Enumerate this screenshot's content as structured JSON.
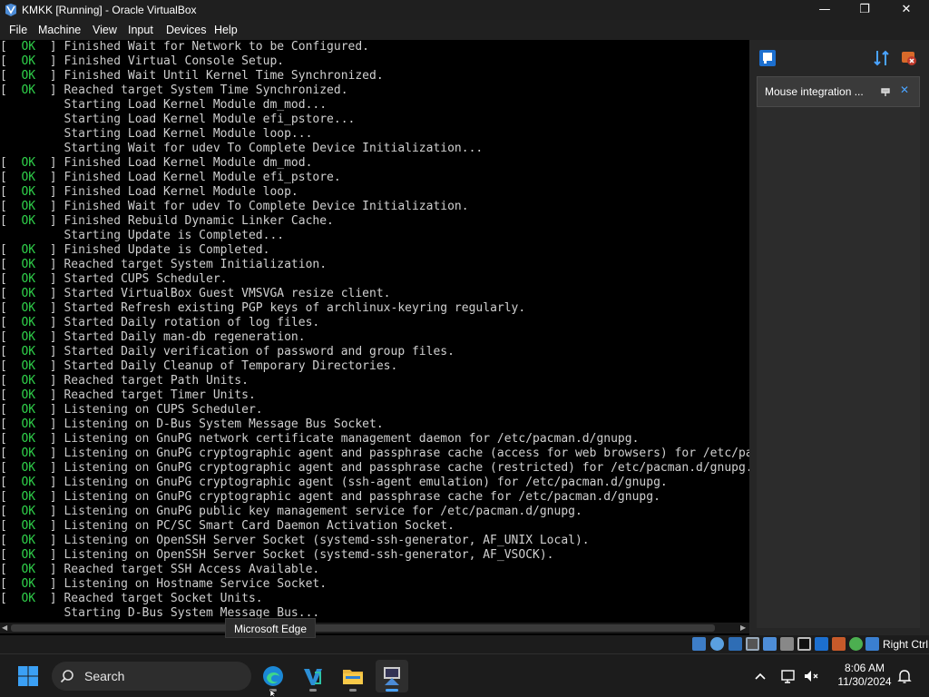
{
  "window": {
    "title": "KMKK [Running] - Oracle VirtualBox",
    "controls": {
      "minimize": "—",
      "maximize": "❐",
      "close": "✕"
    }
  },
  "menu": [
    "File",
    "Machine",
    "View",
    "Input",
    "Devices",
    "Help"
  ],
  "console": {
    "lines": [
      {
        "s": "ok",
        "verb": "Finished",
        "text": "Wait for Network to be Configured."
      },
      {
        "s": "ok",
        "verb": "Finished",
        "text": "Virtual Console Setup."
      },
      {
        "s": "ok",
        "verb": "Finished",
        "text": "Wait Until Kernel Time Synchronized."
      },
      {
        "s": "ok",
        "verb": "Reached target",
        "text": "System Time Synchronized."
      },
      {
        "s": "",
        "verb": "Starting",
        "text": "Load Kernel Module dm_mod..."
      },
      {
        "s": "",
        "verb": "Starting",
        "text": "Load Kernel Module efi_pstore..."
      },
      {
        "s": "",
        "verb": "Starting",
        "text": "Load Kernel Module loop..."
      },
      {
        "s": "",
        "verb": "Starting",
        "text": "Wait for udev To Complete Device Initialization..."
      },
      {
        "s": "ok",
        "verb": "Finished",
        "text": "Load Kernel Module dm_mod."
      },
      {
        "s": "ok",
        "verb": "Finished",
        "text": "Load Kernel Module efi_pstore."
      },
      {
        "s": "ok",
        "verb": "Finished",
        "text": "Load Kernel Module loop."
      },
      {
        "s": "ok",
        "verb": "Finished",
        "text": "Wait for udev To Complete Device Initialization."
      },
      {
        "s": "ok",
        "verb": "Finished",
        "text": "Rebuild Dynamic Linker Cache."
      },
      {
        "s": "",
        "verb": "Starting",
        "text": "Update is Completed..."
      },
      {
        "s": "ok",
        "verb": "Finished",
        "text": "Update is Completed."
      },
      {
        "s": "ok",
        "verb": "Reached target",
        "text": "System Initialization."
      },
      {
        "s": "ok",
        "verb": "Started",
        "text": "CUPS Scheduler."
      },
      {
        "s": "ok",
        "verb": "Started",
        "text": "VirtualBox Guest VMSVGA resize client."
      },
      {
        "s": "ok",
        "verb": "Started",
        "text": "Refresh existing PGP keys of archlinux-keyring regularly."
      },
      {
        "s": "ok",
        "verb": "Started",
        "text": "Daily rotation of log files."
      },
      {
        "s": "ok",
        "verb": "Started",
        "text": "Daily man-db regeneration."
      },
      {
        "s": "ok",
        "verb": "Started",
        "text": "Daily verification of password and group files."
      },
      {
        "s": "ok",
        "verb": "Started",
        "text": "Daily Cleanup of Temporary Directories."
      },
      {
        "s": "ok",
        "verb": "Reached target",
        "text": "Path Units."
      },
      {
        "s": "ok",
        "verb": "Reached target",
        "text": "Timer Units."
      },
      {
        "s": "ok",
        "verb": "Listening on",
        "text": "CUPS Scheduler."
      },
      {
        "s": "ok",
        "verb": "Listening on",
        "text": "D-Bus System Message Bus Socket."
      },
      {
        "s": "ok",
        "verb": "Listening on",
        "text": "GnuPG network certificate management daemon for /etc/pacman.d/gnupg."
      },
      {
        "s": "ok",
        "verb": "Listening on",
        "text": "GnuPG cryptographic agent and passphrase cache (access for web browsers) for /etc/pacman.d/gnupg."
      },
      {
        "s": "ok",
        "verb": "Listening on",
        "text": "GnuPG cryptographic agent and passphrase cache (restricted) for /etc/pacman.d/gnupg."
      },
      {
        "s": "ok",
        "verb": "Listening on",
        "text": "GnuPG cryptographic agent (ssh-agent emulation) for /etc/pacman.d/gnupg."
      },
      {
        "s": "ok",
        "verb": "Listening on",
        "text": "GnuPG cryptographic agent and passphrase cache for /etc/pacman.d/gnupg."
      },
      {
        "s": "ok",
        "verb": "Listening on",
        "text": "GnuPG public key management service for /etc/pacman.d/gnupg."
      },
      {
        "s": "ok",
        "verb": "Listening on",
        "text": "PC/SC Smart Card Daemon Activation Socket."
      },
      {
        "s": "ok",
        "verb": "Listening on",
        "text": "OpenSSH Server Socket (systemd-ssh-generator, AF_UNIX Local)."
      },
      {
        "s": "ok",
        "verb": "Listening on",
        "text": "OpenSSH Server Socket (systemd-ssh-generator, AF_VSOCK)."
      },
      {
        "s": "ok",
        "verb": "Reached target",
        "text": "SSH Access Available."
      },
      {
        "s": "ok",
        "verb": "Listening on",
        "text": "Hostname Service Socket."
      },
      {
        "s": "ok",
        "verb": "Reached target",
        "text": "Socket Units."
      },
      {
        "s": "",
        "verb": "Starting",
        "text": "D-Bus System Message Bus..."
      }
    ]
  },
  "side_panel": {
    "notification": "Mouse integration ...",
    "close_glyph": "✕"
  },
  "statusbar": {
    "host_key": "Right Ctrl"
  },
  "tooltip": "Microsoft Edge",
  "taskbar": {
    "search_placeholder": "Search",
    "time": "8:06 AM",
    "date": "11/30/2024"
  },
  "colors": {
    "ok_green": "#2fd04a",
    "accent_blue": "#4aa3ff"
  }
}
